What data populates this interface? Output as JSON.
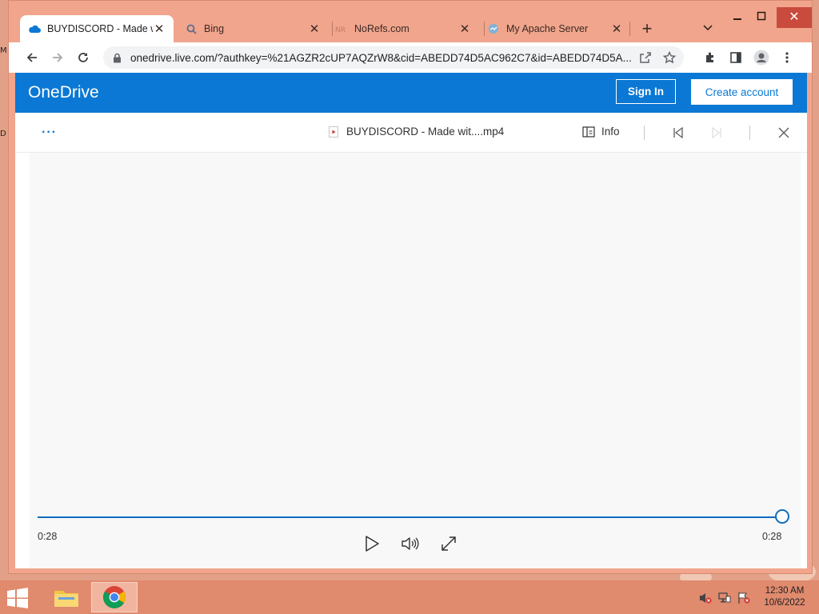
{
  "browser": {
    "tabs": [
      {
        "title": "BUYDISCORD - Made w",
        "icon": "onedrive-cloud-icon",
        "active": true
      },
      {
        "title": "Bing",
        "icon": "search-icon",
        "active": false
      },
      {
        "title": "NoRefs.com",
        "icon": "norefs-icon",
        "active": false
      },
      {
        "title": "My Apache Server",
        "icon": "apache-icon",
        "active": false
      }
    ],
    "new_tab_symbol": "+",
    "address": "onedrive.live.com/?authkey=%21AGZR2cUP7AQZrW8&cid=ABEDD74D5AC962C7&id=ABEDD74D5A..."
  },
  "onedrive": {
    "logo": "OneDrive",
    "sign_in": "Sign In",
    "create_account": "Create account"
  },
  "viewer": {
    "more": "···",
    "file_name": "BUYDISCORD - Made wit....mp4",
    "info": "Info"
  },
  "player": {
    "current_time": "0:28",
    "duration": "0:28",
    "progress": 1.0
  },
  "taskbar": {
    "time": "12:30 AM",
    "date": "10/6/2022"
  },
  "colors": {
    "onedrive_blue": "#0a78d4",
    "window_frame": "#f0a58c",
    "taskbar": "#e08a6e"
  }
}
